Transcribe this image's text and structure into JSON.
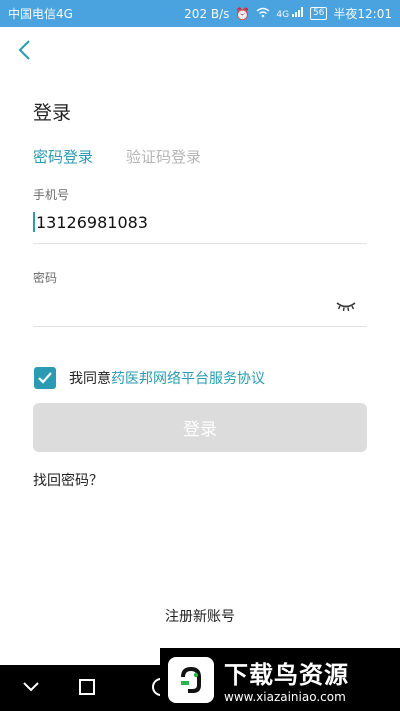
{
  "status_bar": {
    "carrier": "中国电信4G",
    "speed": "202 B/s",
    "signal": "4G",
    "battery": "56",
    "time": "半夜12:01"
  },
  "header": {
    "title": "登录"
  },
  "tabs": [
    {
      "label": "密码登录",
      "active": true
    },
    {
      "label": "验证码登录",
      "active": false
    }
  ],
  "form": {
    "phone_label": "手机号",
    "phone_value": "13126981083",
    "password_label": "密码"
  },
  "agreement": {
    "checked": true,
    "prefix": "我同意",
    "link": "药医邦网络平台服务协议"
  },
  "actions": {
    "login_label": "登录",
    "forgot_label": "找回密码？",
    "register_label": "注册新账号"
  },
  "watermark": {
    "title": "下载鸟资源",
    "url": "www.xiazainiao.com"
  },
  "colors": {
    "accent": "#2a9bb2",
    "status_bar": "#4aa3df",
    "disabled_button": "#dcdcdc"
  }
}
